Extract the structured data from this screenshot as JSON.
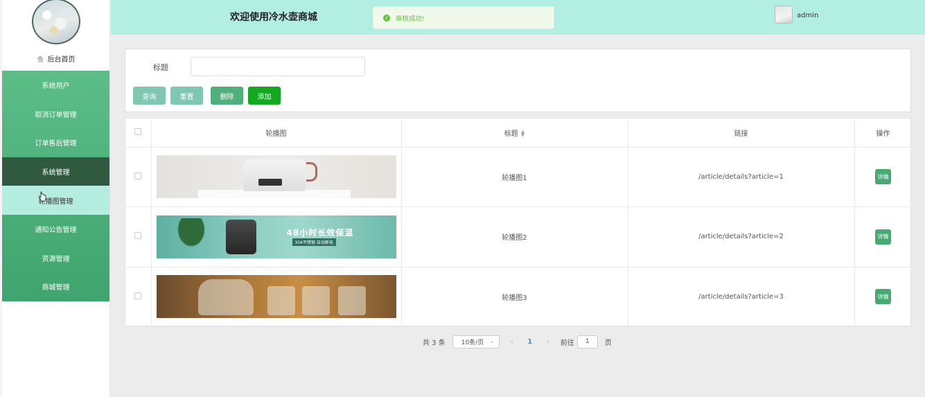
{
  "sidebar": {
    "home_label": "后台首页",
    "items": [
      {
        "label": "系统用户"
      },
      {
        "label": "取消订单管理"
      },
      {
        "label": "订单售后管理"
      },
      {
        "label": "系统管理"
      },
      {
        "label": "轮播图管理"
      },
      {
        "label": "通知公告管理"
      },
      {
        "label": "资源管理"
      },
      {
        "label": "商城管理"
      }
    ]
  },
  "header": {
    "title": "欢迎使用冷水壶商城",
    "user_name": "admin"
  },
  "toast": {
    "message": "审核成功!",
    "status_color": "#67c23a"
  },
  "search": {
    "title_label": "标题",
    "title_value": "",
    "buttons": {
      "query": "查询",
      "reset": "重置",
      "delete": "删除",
      "add": "添加"
    }
  },
  "table": {
    "columns": {
      "image": "轮播图",
      "title": "标题",
      "link": "链接",
      "action": "操作"
    },
    "rows": [
      {
        "title": "轮播图1",
        "link": "/article/details?article=1",
        "action": "详情"
      },
      {
        "title": "轮播图2",
        "link": "/article/details?article=2",
        "action": "详情",
        "banner_text": "48小时长效保温",
        "banner_sub": "304不锈钢 自动断电"
      },
      {
        "title": "轮播图3",
        "link": "/article/details?article=3",
        "action": "详情"
      }
    ]
  },
  "pagination": {
    "total": "共 3 条",
    "page_size": "10条/页",
    "current_page": "1",
    "goto_prefix": "前往",
    "goto_value": "1",
    "goto_suffix": "页"
  },
  "colors": {
    "header_bg": "#b3eee3",
    "menu_green": "#4fb07c",
    "menu_active": "#2f5a3f",
    "menu_selected": "#b4ede0",
    "add_button": "#12a81f"
  }
}
